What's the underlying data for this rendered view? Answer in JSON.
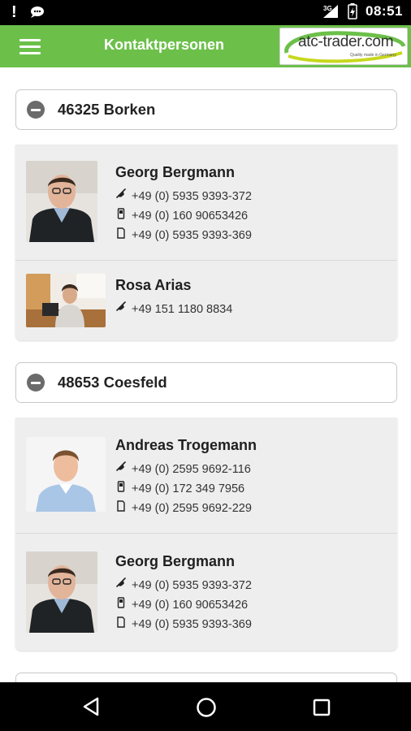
{
  "status_bar": {
    "time": "08:51",
    "network": "3G"
  },
  "app_bar": {
    "title": "Kontaktpersonen",
    "logo_text": "atc-trader.com",
    "logo_tagline": "Quality made in Germany",
    "accent_color": "#6cc04a"
  },
  "groups": [
    {
      "title": "46325 Borken",
      "contacts": [
        {
          "name": "Georg Bergmann",
          "phone": "+49 (0) 5935 9393-372",
          "mobile": "+49 (0) 160 90653426",
          "fax": "+49 (0) 5935 9393-369"
        },
        {
          "name": "Rosa Arias",
          "phone": "+49 151 1180 8834"
        }
      ]
    },
    {
      "title": "48653 Coesfeld",
      "contacts": [
        {
          "name": "Andreas Trogemann",
          "phone": "+49 (0) 2595 9692-116",
          "mobile": "+49 (0) 172 349 7956",
          "fax": "+49 (0) 2595 9692-229"
        },
        {
          "name": "Georg Bergmann",
          "phone": "+49 (0) 5935 9393-372",
          "mobile": "+49 (0) 160 90653426",
          "fax": "+49 (0) 5935 9393-369"
        }
      ]
    }
  ],
  "icons": {
    "phone": "phone-icon",
    "mobile": "mobile-phone-icon",
    "fax": "fax-icon",
    "collapse": "minus-circle-icon"
  }
}
